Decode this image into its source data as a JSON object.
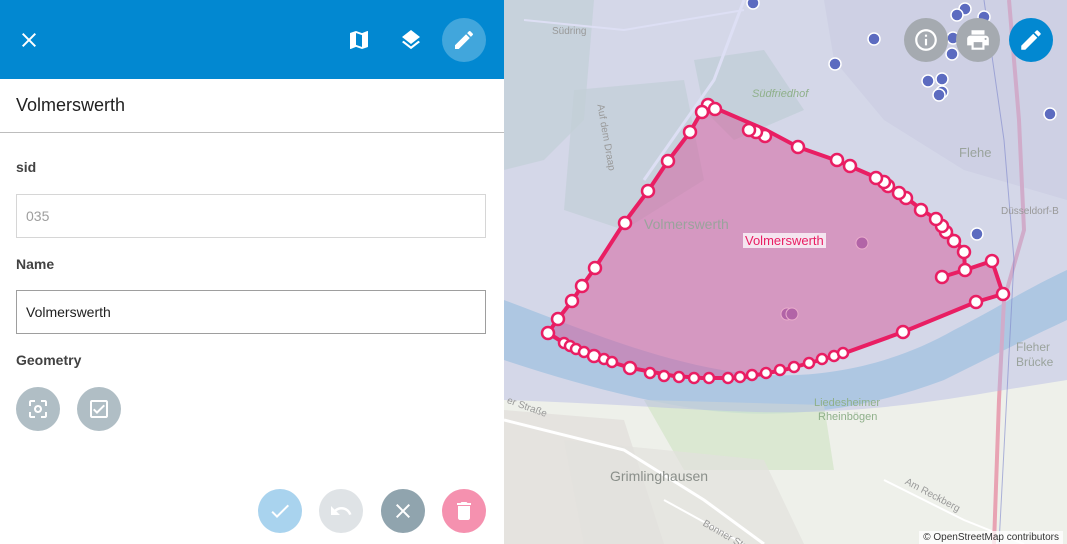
{
  "toolbar": {
    "close_icon": "close-icon",
    "map_icon": "map-icon",
    "layers_icon": "layers-icon",
    "edit_icon": "pencil-icon",
    "bar_color": "#0288d1"
  },
  "form": {
    "title": "Volmerswerth",
    "fields": {
      "sid": {
        "label": "sid",
        "placeholder": "035",
        "value": ""
      },
      "name": {
        "label": "Name",
        "value": "Volmerswerth"
      },
      "geometry": {
        "label": "Geometry"
      }
    }
  },
  "actions": {
    "confirm_icon": "check-icon",
    "undo_icon": "undo-icon",
    "cancel_icon": "close-icon",
    "delete_icon": "trash-icon"
  },
  "map": {
    "feature_label": "Volmerswerth",
    "place_labels": {
      "volmerswerth": "Volmerswerth",
      "grimlinghausen": "Grimlinghausen",
      "flehe": "Flehe",
      "fleher_bruecke_1": "Fleher",
      "fleher_bruecke_2": "Brücke",
      "liedesheimer_1": "Liedesheimer",
      "liedesheimer_2": "Rheinbögen",
      "suedfriedhof": "Südfriedhof",
      "suedring": "Südring",
      "am_reckberg": "Am Reckberg",
      "auf_dem_draap": "Auf dem Draap",
      "bonner_str": "Bonner Str.",
      "kaiser_str": "er Straße",
      "duesseldorf_b": "Düsseldorf-B"
    },
    "attribution": "© OpenStreetMap contributors",
    "polygon_color": "#e91e63",
    "overlay_color": "#b4b9e6"
  }
}
